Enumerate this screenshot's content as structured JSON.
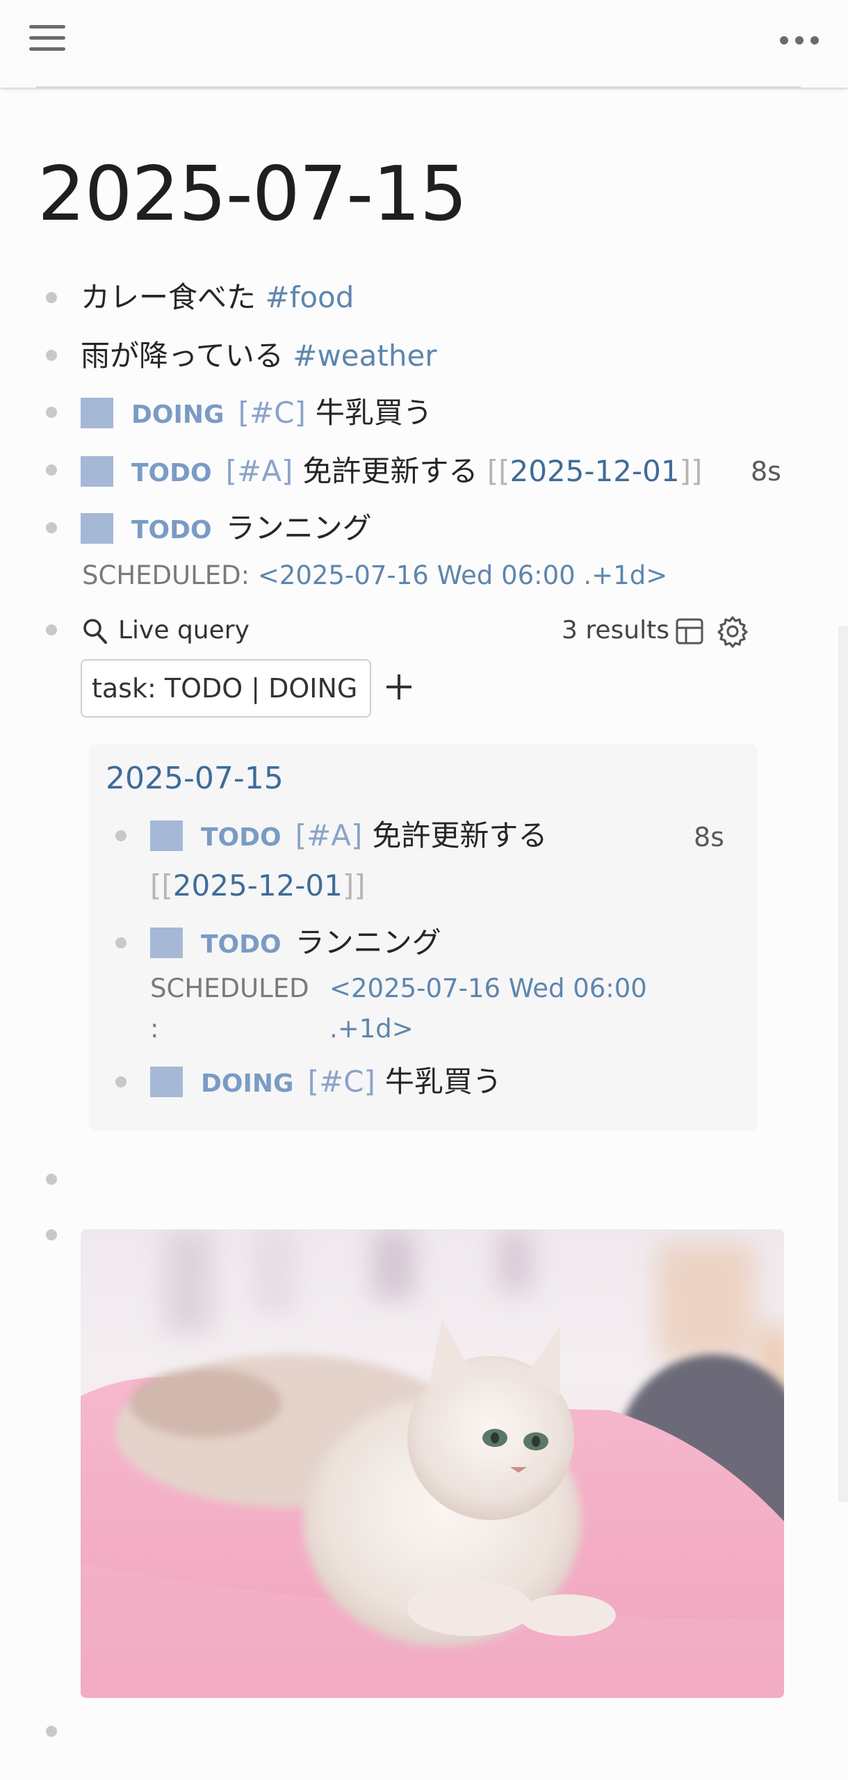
{
  "header": {
    "menu_icon": "hamburger-icon",
    "more_icon": "ellipsis-icon"
  },
  "page": {
    "title": "2025-07-15"
  },
  "blocks": [
    {
      "text": "カレー食べた",
      "tag": "#food"
    },
    {
      "text": "雨が降っている",
      "tag": "#weather"
    },
    {
      "marker": "DOING",
      "priority": "[#C]",
      "text": "牛乳買う"
    },
    {
      "marker": "TODO",
      "priority": "[#A]",
      "text": "免許更新する",
      "link_open": "[[",
      "link": "2025-12-01",
      "link_close": "]]",
      "timer": "8s"
    },
    {
      "marker": "TODO",
      "text": "ランニング",
      "scheduled_label": "SCHEDULED:",
      "scheduled_value": "<2025-07-16 Wed 06:00 .+1d>"
    }
  ],
  "query": {
    "icon": "search-icon",
    "title": "Live query",
    "results": "3 results",
    "input_value": "task: TODO | DOING",
    "results_card": {
      "page": "2025-07-15",
      "items": [
        {
          "marker": "TODO",
          "priority": "[#A]",
          "text": "免許更新する",
          "link_open": "[[",
          "link": "2025-12-01",
          "link_close": "]]",
          "timer": "8s"
        },
        {
          "marker": "TODO",
          "text": "ランニング",
          "scheduled_label_1": "SCHEDULED",
          "scheduled_label_2": ":",
          "scheduled_value_1": "<2025-07-16 Wed 06:00",
          "scheduled_value_2": ".+1d>"
        },
        {
          "marker": "DOING",
          "priority": "[#C]",
          "text": "牛乳買う"
        }
      ]
    }
  },
  "image": {
    "subject": "cat-photo"
  },
  "colors": {
    "tag": "#5e86ad",
    "marker": "#7a9bc4",
    "checkbox": "#a5b8d6",
    "page_link": "#3f6c98"
  }
}
